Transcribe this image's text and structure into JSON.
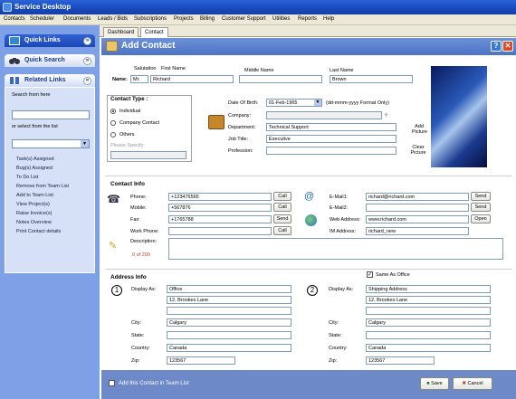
{
  "window": {
    "title": "Service Desktop"
  },
  "menu": [
    "Contacts",
    "Scheduler",
    "Documents",
    "Leads / Bids",
    "Subscriptions",
    "Projects",
    "Billing",
    "Customer Support",
    "Utilities",
    "Reports",
    "Help"
  ],
  "sidebar": {
    "quick_links": "Quick Links",
    "quick_search": "Quick Search",
    "related_links": "Related Links",
    "search_from_here": "Search from here",
    "select_from_list": "or select from the list",
    "links": [
      "Task(s) Assigned",
      "Bug(s) Assigned",
      "To Do List",
      "Remove from Team List",
      "Add to Team List",
      "View Project(s)",
      "Raise Invoice(s)",
      "Notes Overview",
      "Print Contact details"
    ]
  },
  "tabs": [
    "Dashboard",
    "Contact"
  ],
  "header": {
    "title": "Add Contact"
  },
  "name": {
    "label": "Name:",
    "salutation_label": "Salutation",
    "first_label": "First Name",
    "middle_label": "Middle Name",
    "last_label": "Last Name",
    "salutation": "Mr.",
    "first": "Richard",
    "middle": "",
    "last": "Brown"
  },
  "contact_type": {
    "title": "Contact Type :",
    "options": [
      "Individual",
      "Company Contact",
      "Others"
    ],
    "selected": "Individual",
    "please_specify": "Please Specify:"
  },
  "details": {
    "dob_label": "Date Of Birth:",
    "dob": "01-Feb-1965",
    "dob_hint": "(dd-mmm-yyyy Format Only)",
    "company_label": "Company:",
    "department_label": "Department:",
    "department": "Technical Support",
    "jobtitle_label": "Job Title:",
    "jobtitle": "Executive",
    "profession_label": "Profession:"
  },
  "picture": {
    "add": [
      "Add",
      "Picture"
    ],
    "clear": [
      "Clear",
      "Picture"
    ]
  },
  "contact_info": {
    "title": "Contact Info",
    "phone_label": "Phone:",
    "phone": "+123476565",
    "mobile_label": "Mobile:",
    "mobile": "+567876",
    "fax_label": "Fax:",
    "fax": "+1765788",
    "workphone_label": "Work Phone:",
    "description_label": "Description:",
    "char_count": "0 of 200",
    "email1_label": "E-Mail1:",
    "email1": "richard@richard.com",
    "email2_label": "E-Mail2:",
    "web_label": "Web Address:",
    "web": "www.richard.com",
    "im_label": "IM Address:",
    "im": "richard_new",
    "call": "Call",
    "send": "Send",
    "open": "Open"
  },
  "address_info": {
    "title": "Address Info",
    "same_as_office": "Same As Office",
    "display_label": "Display As:",
    "city_label": "City:",
    "state_label": "State:",
    "country_label": "Country:",
    "zip_label": "Zip:",
    "a1": {
      "num": "1",
      "display": "Office",
      "line1": "12, Brookes Lane",
      "city": "Calgary",
      "state": "",
      "country": "Canada",
      "zip": "123567"
    },
    "a2": {
      "num": "2",
      "display": "Shipping Address",
      "line1": "12, Brookes Lane",
      "city": "Calgary",
      "state": "",
      "country": "Canada",
      "zip": "123567"
    }
  },
  "footer": {
    "team_label": "Add this Contact in Team List",
    "save": "Save",
    "cancel": "Cancel"
  }
}
